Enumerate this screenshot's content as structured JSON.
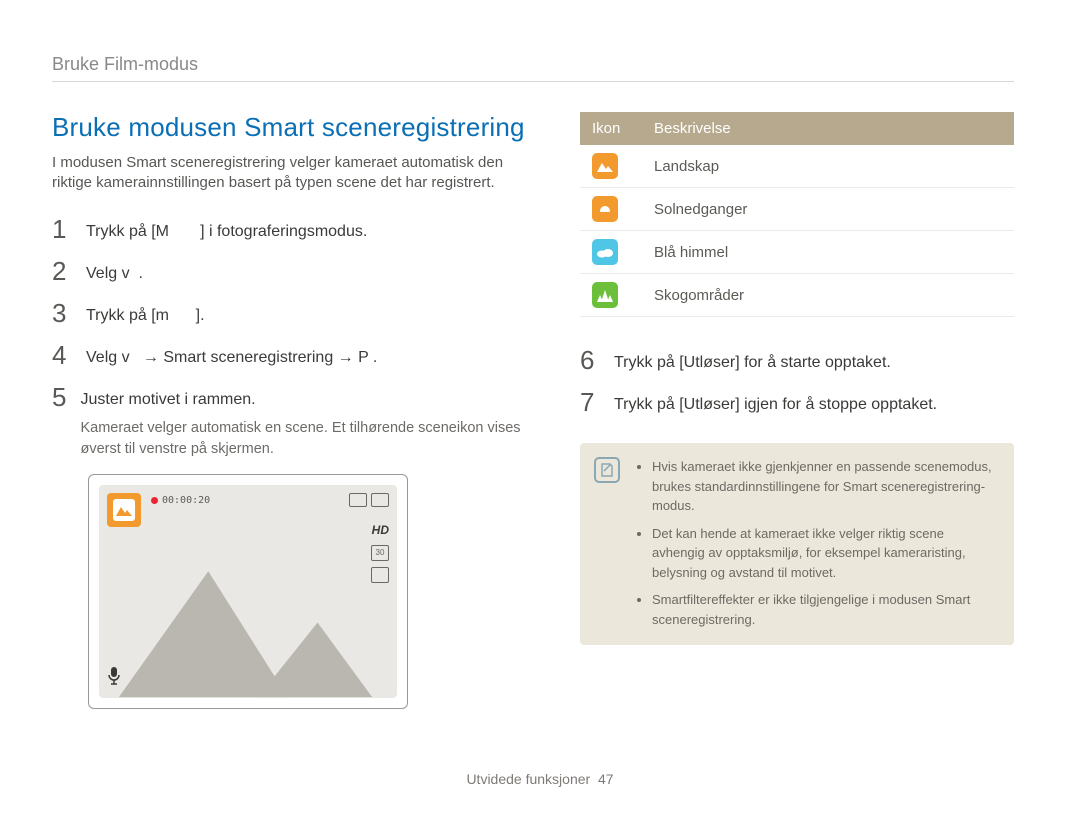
{
  "breadcrumb": "Bruke Film-modus",
  "title": "Bruke modusen Smart sceneregistrering",
  "intro": "I modusen Smart sceneregistrering velger kameraet automatisk den riktige kamerainnstillingen basert på typen scene det har registrert.",
  "stepsLeft": [
    {
      "num": "1",
      "text": "Trykk på [M       ] i fotograferingsmodus."
    },
    {
      "num": "2",
      "text": "Velg v  ."
    },
    {
      "num": "3",
      "text": "Trykk på [m      ]."
    },
    {
      "num": "4",
      "text": "Velg v   → Smart sceneregistrering → P ."
    },
    {
      "num": "5",
      "text": "Juster motivet i rammen.",
      "sub": "Kameraet velger automatisk en scene. Et tilhørende sceneikon vises øverst til venstre på skjermen."
    }
  ],
  "stepsRight": [
    {
      "num": "6",
      "text": "Trykk på [Utløser] for å starte opptaket."
    },
    {
      "num": "7",
      "text": "Trykk på [Utløser] igjen for å stoppe opptaket."
    }
  ],
  "table": {
    "headers": {
      "icon": "Ikon",
      "desc": "Beskrivelse"
    },
    "rows": [
      {
        "cls": "ic-landscape",
        "svg": "landscape",
        "desc": "Landskap"
      },
      {
        "cls": "ic-sunset",
        "svg": "sunset",
        "desc": "Solnedganger"
      },
      {
        "cls": "ic-sky",
        "svg": "sky",
        "desc": "Blå himmel"
      },
      {
        "cls": "ic-forest",
        "svg": "forest",
        "desc": "Skogområder"
      }
    ]
  },
  "note": {
    "items": [
      "Hvis kameraet ikke gjenkjenner en passende scenemodus, brukes standardinnstillingene for Smart sceneregistrering-modus.",
      "Det kan hende at kameraet ikke velger riktig scene avhengig av opptaksmiljø, for eksempel kameraristing, belysning og avstand til motivet.",
      "Smartfiltereffekter er ikke tilgjengelige i modusen Smart sceneregistrering."
    ]
  },
  "screen": {
    "timer": "00:00:20",
    "hd": "HD",
    "sd": "30"
  },
  "footer": {
    "label": "Utvidede funksjoner",
    "page": "47"
  }
}
